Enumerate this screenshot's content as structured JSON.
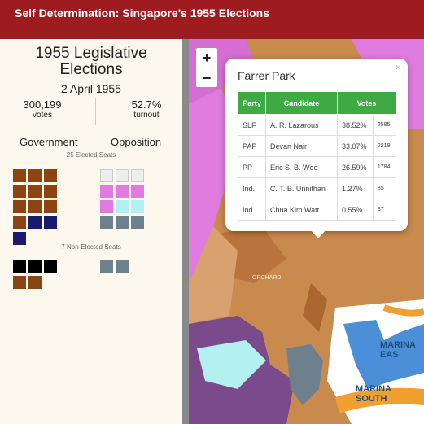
{
  "header": {
    "title": "Self Determination: Singapore's 1955 Elections"
  },
  "sidebar": {
    "title_line1": "1955 Legislative",
    "title_line2": "Elections",
    "date": "2 April 1955",
    "votes_value": "300,199",
    "votes_label": "votes",
    "turnout_value": "52.7%",
    "turnout_label": "turnout",
    "government_label": "Government",
    "opposition_label": "Opposition",
    "elected_seats_label": "25 Elected Seats",
    "non_elected_seats_label": "7 Non-Elected Seats"
  },
  "colors": {
    "slf": "#8b4513",
    "navy": "#1a1a6e",
    "pap": "#e07be0",
    "pp": "#b3f0f0",
    "ind": "#6e7f8e",
    "empty": "#eeeeee",
    "black": "#000000",
    "green": "#3daa44"
  },
  "map": {
    "zoom_in": "+",
    "zoom_out": "−",
    "labels": [
      "ORCHARD",
      "MARINA EAS",
      "MARINA SOUTH"
    ]
  },
  "popup": {
    "title": "Farrer Park",
    "close": "×",
    "headers": [
      "Party",
      "Candidate",
      "Votes"
    ],
    "rows": [
      {
        "party": "SLF",
        "candidate": "A. R. Lazarous",
        "pct": "38.52%",
        "votes": "2585"
      },
      {
        "party": "PAP",
        "candidate": "Devan Nair",
        "pct": "33.07%",
        "votes": "2219"
      },
      {
        "party": "PP",
        "candidate": "Eric S. B. Wee",
        "pct": "26.59%",
        "votes": "1784"
      },
      {
        "party": "Ind.",
        "candidate": "C. T. B. Unnithan",
        "pct": "1.27%",
        "votes": "85"
      },
      {
        "party": "Ind.",
        "candidate": "Chua Kim Watt",
        "pct": "0.55%",
        "votes": "37"
      }
    ]
  }
}
